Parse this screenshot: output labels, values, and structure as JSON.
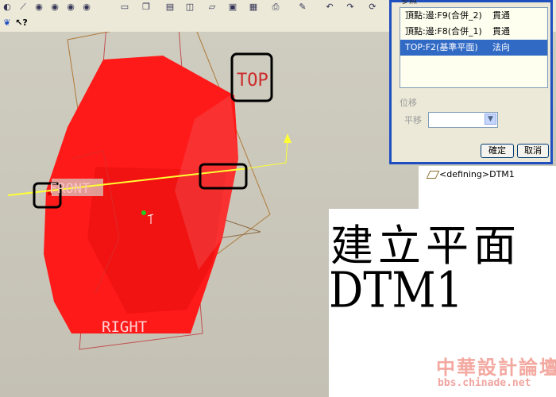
{
  "dialog": {
    "references": [
      {
        "name": "頂點:邊:F9(合併_2)",
        "type": "貫通"
      },
      {
        "name": "頂點:邊:F8(合併_1)",
        "type": "貫通"
      },
      {
        "name": "TOP:F2(基準平面)",
        "type": "法向"
      }
    ],
    "offset_group_label": "位移",
    "translation_label": "平移",
    "translation_value": "",
    "ok_label": "確定",
    "cancel_label": "取消",
    "top_fragment": "參照"
  },
  "model_tree": {
    "item": "<defining>DTM1"
  },
  "viewport": {
    "label_top": "TOP",
    "label_front": "FRONT",
    "label_right": "RIGHT"
  },
  "caption": {
    "line1": "建立平面",
    "line2": "DTM1"
  },
  "watermark": {
    "name": "中華設計論壇",
    "url": "bbs.chinade.net"
  },
  "colors": {
    "part": "#ff1a1a",
    "highlight_box": "#000000",
    "axis": "#ffff33",
    "dialog_border": "#1f4fbf",
    "selection": "#316ac5"
  },
  "icons": [
    "eye-icon",
    "what-is-this-icon",
    "datum-plane-icon",
    "dropdown-arrow-icon"
  ]
}
